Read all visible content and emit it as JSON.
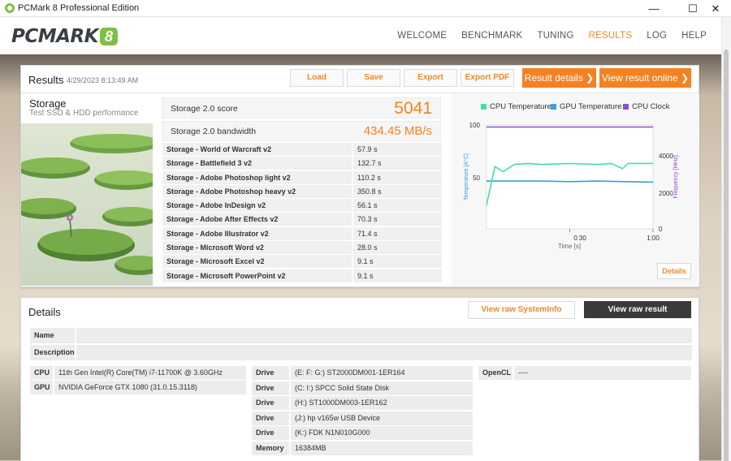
{
  "window": {
    "title": "PCMark 8 Professional Edition",
    "minimize": "—",
    "maximize": "☐",
    "close": "✕"
  },
  "logo": {
    "text": "PCMARK",
    "number": "8"
  },
  "nav": [
    {
      "label": "WELCOME",
      "active": false
    },
    {
      "label": "BENCHMARK",
      "active": false
    },
    {
      "label": "TUNING",
      "active": false
    },
    {
      "label": "RESULTS",
      "active": true
    },
    {
      "label": "LOG",
      "active": false
    },
    {
      "label": "HELP",
      "active": false
    }
  ],
  "results": {
    "title": "Results",
    "date": "4/29/2023 8:13:49 AM",
    "buttons": {
      "load": "Load",
      "save": "Save",
      "export": "Export",
      "export_pdf": "Export PDF",
      "result_details": "Result details ❯",
      "view_online": "View result online ❯"
    },
    "storage": {
      "title": "Storage",
      "subtitle": "Test SSD & HDD performance"
    },
    "score": {
      "label": "Storage 2.0 score",
      "value": "5041"
    },
    "bandwidth": {
      "label": "Storage 2.0 bandwidth",
      "value": "434.45 MB/s"
    },
    "tests": [
      {
        "name": "Storage - World of Warcraft v2",
        "value": "57.9 s"
      },
      {
        "name": "Storage - Battlefield 3 v2",
        "value": "132.7 s"
      },
      {
        "name": "Storage - Adobe Photoshop light v2",
        "value": "110.2 s"
      },
      {
        "name": "Storage - Adobe Photoshop heavy v2",
        "value": "350.8 s"
      },
      {
        "name": "Storage - Adobe InDesign v2",
        "value": "56.1 s"
      },
      {
        "name": "Storage - Adobe After Effects v2",
        "value": "70.3 s"
      },
      {
        "name": "Storage - Adobe Illustrator v2",
        "value": "71.4 s"
      },
      {
        "name": "Storage - Microsoft Word v2",
        "value": "28.0 s"
      },
      {
        "name": "Storage - Microsoft Excel v2",
        "value": "9.1 s"
      },
      {
        "name": "Storage - Microsoft PowerPoint v2",
        "value": "9.1 s"
      }
    ]
  },
  "monitor": {
    "legend": [
      {
        "name": "CPU Temperature",
        "color": "#3ee0b0"
      },
      {
        "name": "GPU Temperature",
        "color": "#3a9fe0"
      },
      {
        "name": "CPU Clock",
        "color": "#8e4fc8"
      }
    ],
    "y_left_label": "Temperature [A°C]",
    "y_right_label": "Frequency [MHz]",
    "x_label": "Time [s]",
    "y_left_ticks": [
      "100",
      "50"
    ],
    "y_right_ticks": [
      "4000",
      "2000",
      "0"
    ],
    "x_ticks": [
      "0:30",
      "1:00"
    ],
    "details_button": "Details",
    "series": {
      "cpu_temp": [
        [
          0,
          23
        ],
        [
          3,
          60
        ],
        [
          6,
          55
        ],
        [
          10,
          62
        ],
        [
          15,
          63
        ],
        [
          20,
          62
        ],
        [
          30,
          63
        ],
        [
          40,
          62
        ],
        [
          45,
          63
        ],
        [
          49,
          58
        ],
        [
          51,
          63
        ],
        [
          55,
          63
        ],
        [
          60,
          63
        ]
      ],
      "gpu_temp": [
        [
          0,
          46
        ],
        [
          10,
          46
        ],
        [
          20,
          46
        ],
        [
          30,
          45.5
        ],
        [
          40,
          46
        ],
        [
          50,
          45.5
        ],
        [
          60,
          45
        ]
      ],
      "cpu_clock": [
        [
          0,
          5100
        ],
        [
          60,
          5100
        ]
      ]
    },
    "x_range": [
      0,
      60
    ],
    "y_left_range": [
      0,
      100
    ],
    "y_right_range": [
      0,
      5200
    ]
  },
  "details": {
    "title": "Details",
    "view_sysinfo": "View raw SystemInfo",
    "view_result": "View raw result",
    "name_label": "Name",
    "description_label": "Description",
    "cpu_label": "CPU",
    "cpu_value": "11th Gen Intel(R) Core(TM) i7-11700K @ 3.60GHz",
    "gpu_label": "GPU",
    "gpu_value": "NVIDIA GeForce GTX 1080 (31.0.15.3118)",
    "drives": [
      {
        "label": "Drive",
        "value": "(E: F: G:) ST2000DM001-1ER164"
      },
      {
        "label": "Drive",
        "value": "(C: I:) SPCC Solid State Disk"
      },
      {
        "label": "Drive",
        "value": "(H:) ST1000DM003-1ER162"
      },
      {
        "label": "Drive",
        "value": "(J:) hp v165w USB Device"
      },
      {
        "label": "Drive",
        "value": "(K:) FDK N1N010G000"
      }
    ],
    "memory_label": "Memory",
    "memory_value": "16384MB",
    "opencl_label": "OpenCL",
    "opencl_value": "----"
  }
}
